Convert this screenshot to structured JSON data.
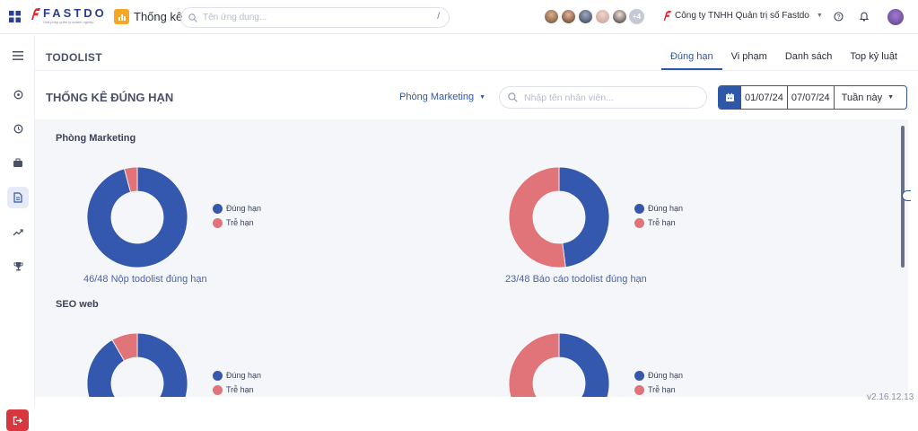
{
  "topbar": {
    "logo": "FASTDO",
    "logo_tagline": "Giải pháp quản lý doanh nghiệp",
    "app_title": "Thống kê",
    "search_placeholder": "Tên ứng dụng...",
    "search_shortcut": "/",
    "more_users": "+4",
    "company": "Công ty TNHH Quản trị số Fastdo"
  },
  "header": {
    "title": "TODOLIST",
    "tabs": [
      "Đúng hạn",
      "Vi phạm",
      "Danh sách",
      "Top kỷ luật"
    ],
    "active_tab": "Đúng hạn"
  },
  "filters": {
    "section_title": "THỐNG KÊ ĐÚNG HẠN",
    "department": "Phòng Marketing",
    "employee_placeholder": "Nhập tên nhân viên...",
    "date_from": "01/07/24",
    "date_to": "07/07/24",
    "period": "Tuần này"
  },
  "legend": {
    "on_time": "Đúng hạn",
    "late": "Trễ hạn"
  },
  "colors": {
    "on_time": "#3358ad",
    "late": "#e07478",
    "accent": "#2f57a8",
    "logout": "#d9363e"
  },
  "groups": [
    {
      "name": "Phòng Marketing",
      "charts": [
        {
          "caption": "46/48 Nộp todolist đúng hạn",
          "on_time": 46,
          "late": 2
        },
        {
          "caption": "23/48 Báo cáo todolist đúng hạn",
          "on_time": 23,
          "late": 25
        }
      ]
    },
    {
      "name": "SEO web",
      "charts": [
        {
          "caption": "",
          "on_time": 44,
          "late": 4
        },
        {
          "caption": "",
          "on_time": 24,
          "late": 24
        }
      ]
    }
  ],
  "chart_data": [
    {
      "type": "pie",
      "group": "Phòng Marketing",
      "caption": "46/48 Nộp todolist đúng hạn",
      "categories": [
        "Đúng hạn",
        "Trễ hạn"
      ],
      "values": [
        46,
        2
      ]
    },
    {
      "type": "pie",
      "group": "Phòng Marketing",
      "caption": "23/48 Báo cáo todolist đúng hạn",
      "categories": [
        "Đúng hạn",
        "Trễ hạn"
      ],
      "values": [
        23,
        25
      ]
    },
    {
      "type": "pie",
      "group": "SEO web",
      "categories": [
        "Đúng hạn",
        "Trễ hạn"
      ],
      "values": [
        44,
        4
      ]
    },
    {
      "type": "pie",
      "group": "SEO web",
      "categories": [
        "Đúng hạn",
        "Trễ hạn"
      ],
      "values": [
        24,
        24
      ]
    }
  ],
  "version": "v2.16.12.13"
}
